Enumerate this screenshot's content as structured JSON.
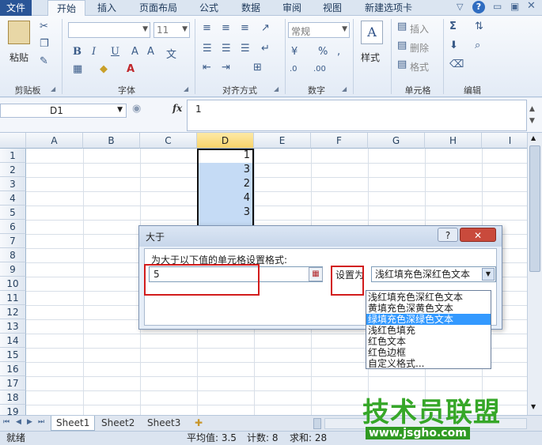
{
  "ribbon": {
    "tabs": [
      "文件",
      "开始",
      "插入",
      "页面布局",
      "公式",
      "数据",
      "审阅",
      "视图",
      "新建选项卡"
    ],
    "groups": {
      "clipboard": "剪贴板",
      "font": "字体",
      "alignment": "对齐方式",
      "number": "数字",
      "cells": "单元格",
      "editing": "编辑"
    },
    "paste_label": "粘贴",
    "font_size": "11",
    "number_format": "常规",
    "style_label": "样式",
    "insert_label": "插入",
    "delete_label": "删除",
    "format_label": "格式",
    "bold": "B",
    "italic": "I",
    "underline": "U"
  },
  "formula_bar": {
    "name_box": "D1",
    "fx": "fx",
    "content": "1"
  },
  "grid": {
    "columns": [
      "A",
      "B",
      "C",
      "D",
      "E",
      "F",
      "G",
      "H",
      "I"
    ],
    "selected_column": "D",
    "rows": [
      "1",
      "2",
      "3",
      "4",
      "5",
      "6",
      "7",
      "8",
      "9",
      "10",
      "11",
      "12",
      "13",
      "14",
      "15",
      "16",
      "17",
      "18",
      "19"
    ],
    "d_values": [
      "1",
      "3",
      "2",
      "4",
      "3"
    ]
  },
  "dialog": {
    "title": "大于",
    "prompt": "为大于以下值的单元格设置格式:",
    "value": "5",
    "set_as_label": "设置为",
    "selected_format": "浅红填充色深红色文本",
    "help_button": "?",
    "close_button": "✕"
  },
  "dropdown": {
    "options": [
      "浅红填充色深红色文本",
      "黄填充色深黄色文本",
      "绿填充色深绿色文本",
      "浅红色填充",
      "红色文本",
      "红色边框",
      "自定义格式..."
    ],
    "selected_index": 2
  },
  "sheets": [
    "Sheet1",
    "Sheet2",
    "Sheet3"
  ],
  "status": {
    "mode": "就绪",
    "average": "平均值: 3.5",
    "count": "计数: 8",
    "sum": "求和: 28"
  },
  "watermark": {
    "line1": "技术员联盟",
    "line2": "www.jsgho.com"
  },
  "colors": {
    "selection_fill": "#c5dbf5",
    "highlight_red": "#d21c1c",
    "dropdown_selected": "#3399ff",
    "watermark_green": "#36a728"
  }
}
